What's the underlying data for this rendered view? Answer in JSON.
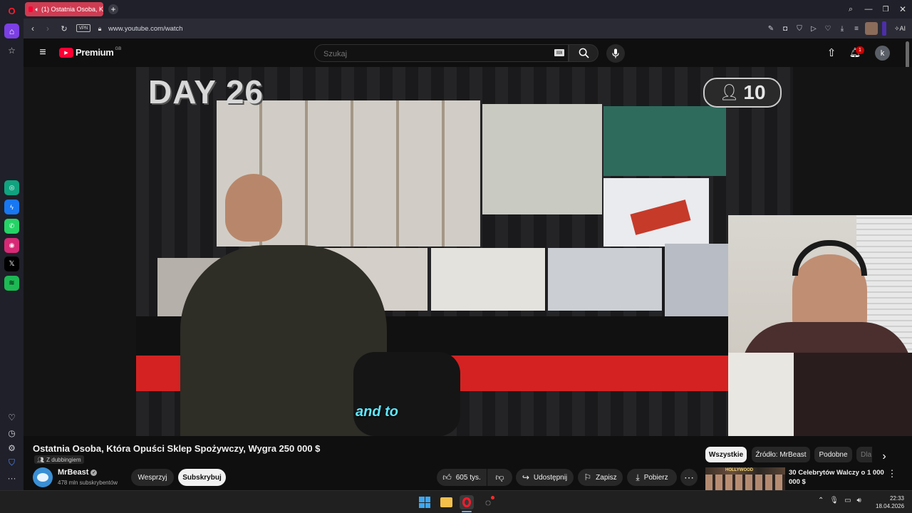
{
  "browser": {
    "tab_title": "(1) Ostatnia Osoba, K",
    "url": "www.youtube.com/watch",
    "vpn_label": "VPN",
    "ai_label": "AI"
  },
  "youtube": {
    "brand": "Premium",
    "region": "GB",
    "search_placeholder": "Szukaj",
    "notification_count": "1",
    "avatar_letter": "k"
  },
  "video": {
    "day_label": "DAY 26",
    "player_count": "10",
    "subtitle": "and to",
    "title": "Ostatnia Osoba, Która Opuści Sklep Spożywczy, Wygra 250 000 $",
    "dubbing_label": "Z dubbingiem"
  },
  "channel": {
    "name": "MrBeast",
    "subscribers": "478 mln subskrybentów",
    "support_label": "Wesprzyj",
    "subscribe_label": "Subskrybuj"
  },
  "actions": {
    "likes": "605 tys.",
    "share": "Udostępnij",
    "save": "Zapisz",
    "download": "Pobierz"
  },
  "chips": [
    "Wszystkie",
    "Źródło: MrBeast",
    "Podobne",
    "Dla"
  ],
  "recommended": {
    "title": "30 Celebrytów Walczy o 1 000 000 $",
    "thumb_text": "HOLLYWOOD"
  },
  "taskbar": {
    "time": "22:33",
    "date": "18.04.2026"
  },
  "colors": {
    "youtube_red": "#ff0033",
    "opera_red": "#cf3c52",
    "accent_purple": "#7b3fe4"
  }
}
